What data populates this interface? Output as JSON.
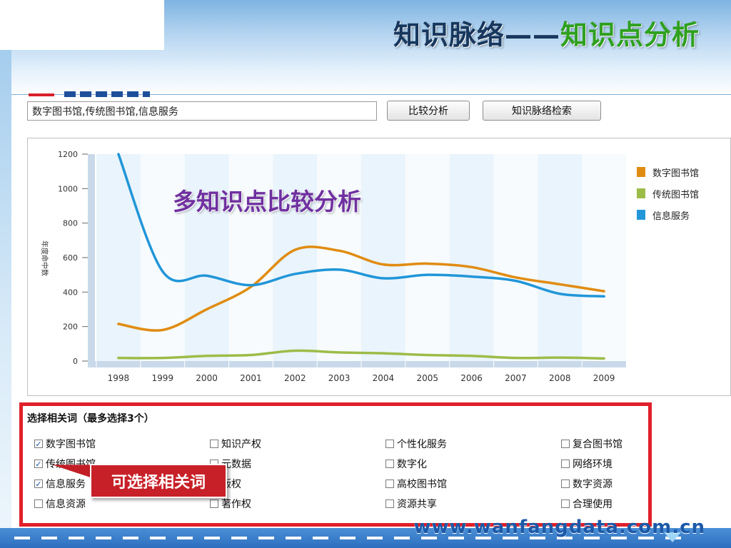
{
  "header": {
    "title_main": "知识脉络",
    "title_dash": "——",
    "title_sub": "知识点分析"
  },
  "search": {
    "value": "数字图书馆,传统图书馆,信息服务",
    "compare_label": "比较分析",
    "trace_label": "知识脉络检索"
  },
  "overlay_text": "多知识点比较分析",
  "colors": {
    "accent_red": "#e0202a",
    "title_blue": "#17375e",
    "title_green": "#2ea01e",
    "overlay_purple": "#7030a0"
  },
  "chart_data": {
    "type": "line",
    "ylabel": "年度命中数",
    "xlabel": "",
    "ylim": [
      0,
      1200
    ],
    "yticks": [
      0,
      200,
      400,
      600,
      800,
      1000,
      1200
    ],
    "x": [
      "1998",
      "1999",
      "2000",
      "2001",
      "2002",
      "2003",
      "2004",
      "2005",
      "2006",
      "2007",
      "2008",
      "2009"
    ],
    "grid": false,
    "legend_position": "right",
    "series": [
      {
        "name": "数字图书馆",
        "color": "#e08c12",
        "values": [
          215,
          180,
          300,
          430,
          645,
          640,
          560,
          565,
          545,
          485,
          445,
          405
        ]
      },
      {
        "name": "传统图书馆",
        "color": "#9cbc48",
        "values": [
          18,
          18,
          30,
          35,
          60,
          50,
          45,
          35,
          30,
          18,
          20,
          15
        ]
      },
      {
        "name": "信息服务",
        "color": "#2196d8",
        "values": [
          1200,
          520,
          495,
          440,
          505,
          530,
          480,
          500,
          490,
          465,
          390,
          375
        ]
      }
    ]
  },
  "keywords": {
    "title": "选择相关词（最多选择3个）",
    "items": [
      {
        "label": "数字图书馆",
        "checked": true
      },
      {
        "label": "知识产权",
        "checked": false
      },
      {
        "label": "个性化服务",
        "checked": false
      },
      {
        "label": "复合图书馆",
        "checked": false
      },
      {
        "label": "传统图书馆",
        "checked": true
      },
      {
        "label": "元数据",
        "checked": false
      },
      {
        "label": "数字化",
        "checked": false
      },
      {
        "label": "网络环境",
        "checked": false
      },
      {
        "label": "信息服务",
        "checked": true
      },
      {
        "label": "版权",
        "checked": false
      },
      {
        "label": "高校图书馆",
        "checked": false
      },
      {
        "label": "数字资源",
        "checked": false
      },
      {
        "label": "信息资源",
        "checked": false
      },
      {
        "label": "著作权",
        "checked": false
      },
      {
        "label": "资源共享",
        "checked": false
      },
      {
        "label": "合理使用",
        "checked": false
      }
    ]
  },
  "callout": "可选择相关词",
  "footer_url": "www.wanfangdata.com.cn"
}
